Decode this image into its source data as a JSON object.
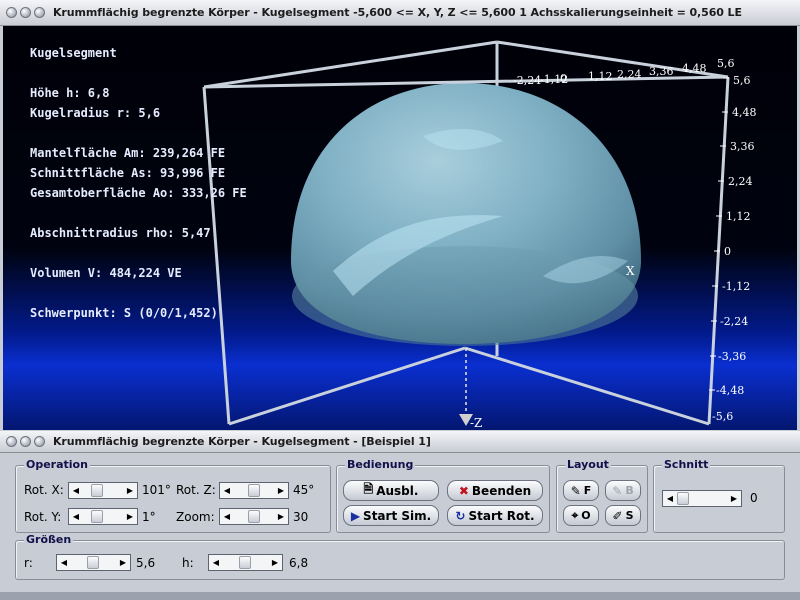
{
  "window1": {
    "title": "Krummflächig begrenzte Körper - Kugelsegment   -5,600 <= X, Y, Z <= 5,600    1 Achsskalierungseinheit = 0,560 LE"
  },
  "info": {
    "heading": "Kugelsegment",
    "hoehe": "Höhe h: 6,8",
    "kugelradius": "Kugelradius r: 5,6",
    "mantelflaeche": "Mantelfläche Am: 239,264 FE",
    "schnittflaeche": "Schnittfläche As: 93,996 FE",
    "gesamtoberflaeche": "Gesamtoberfläche Ao: 333,26 FE",
    "abschnittradius": "Abschnittradius rho: 5,47",
    "volumen": "Volumen V: 484,224 VE",
    "schwerpunkt": "Schwerpunkt: S (0/0/1,452)"
  },
  "axes": {
    "y_ticks": [
      "5,6",
      "4,48",
      "3,36",
      "2,24",
      "1,12",
      "0",
      "-1,12",
      "-2,24",
      "-3,36",
      "-4,48",
      "-5,6"
    ],
    "top_ticks": [
      "-2,24",
      "-1,12",
      "0",
      "1,12",
      "2,24",
      "3,36",
      "4,48",
      "5,6"
    ],
    "x_name": "X",
    "z_name": "-Z",
    "corner_label": "5,6"
  },
  "window2": {
    "title": "Krummflächig begrenzte Körper - Kugelsegment - [Beispiel 1]"
  },
  "operation": {
    "title": "Operation",
    "rotx_label": "Rot. X:",
    "rotx_value": "101°",
    "roty_label": "Rot. Y:",
    "roty_value": "1°",
    "rotz_label": "Rot. Z:",
    "rotz_value": "45°",
    "zoom_label": "Zoom:",
    "zoom_value": "30"
  },
  "bedienung": {
    "title": "Bedienung",
    "ausbl": "Ausbl.",
    "beenden": "Beenden",
    "start_sim": "Start Sim.",
    "start_rot": "Start Rot."
  },
  "layout": {
    "title": "Layout",
    "f": "F",
    "b": "B",
    "o": "O",
    "s": "S"
  },
  "schnitt": {
    "title": "Schnitt",
    "value": "0"
  },
  "groessen": {
    "title": "Größen",
    "r_label": "r:",
    "r_value": "5,6",
    "h_label": "h:",
    "h_value": "6,8"
  },
  "colors": {
    "sphere": "#6e9fb5",
    "scene_bg_top": "#000008",
    "scene_band": "#0a2fd0",
    "panel_bg": "#c8ccd4"
  }
}
